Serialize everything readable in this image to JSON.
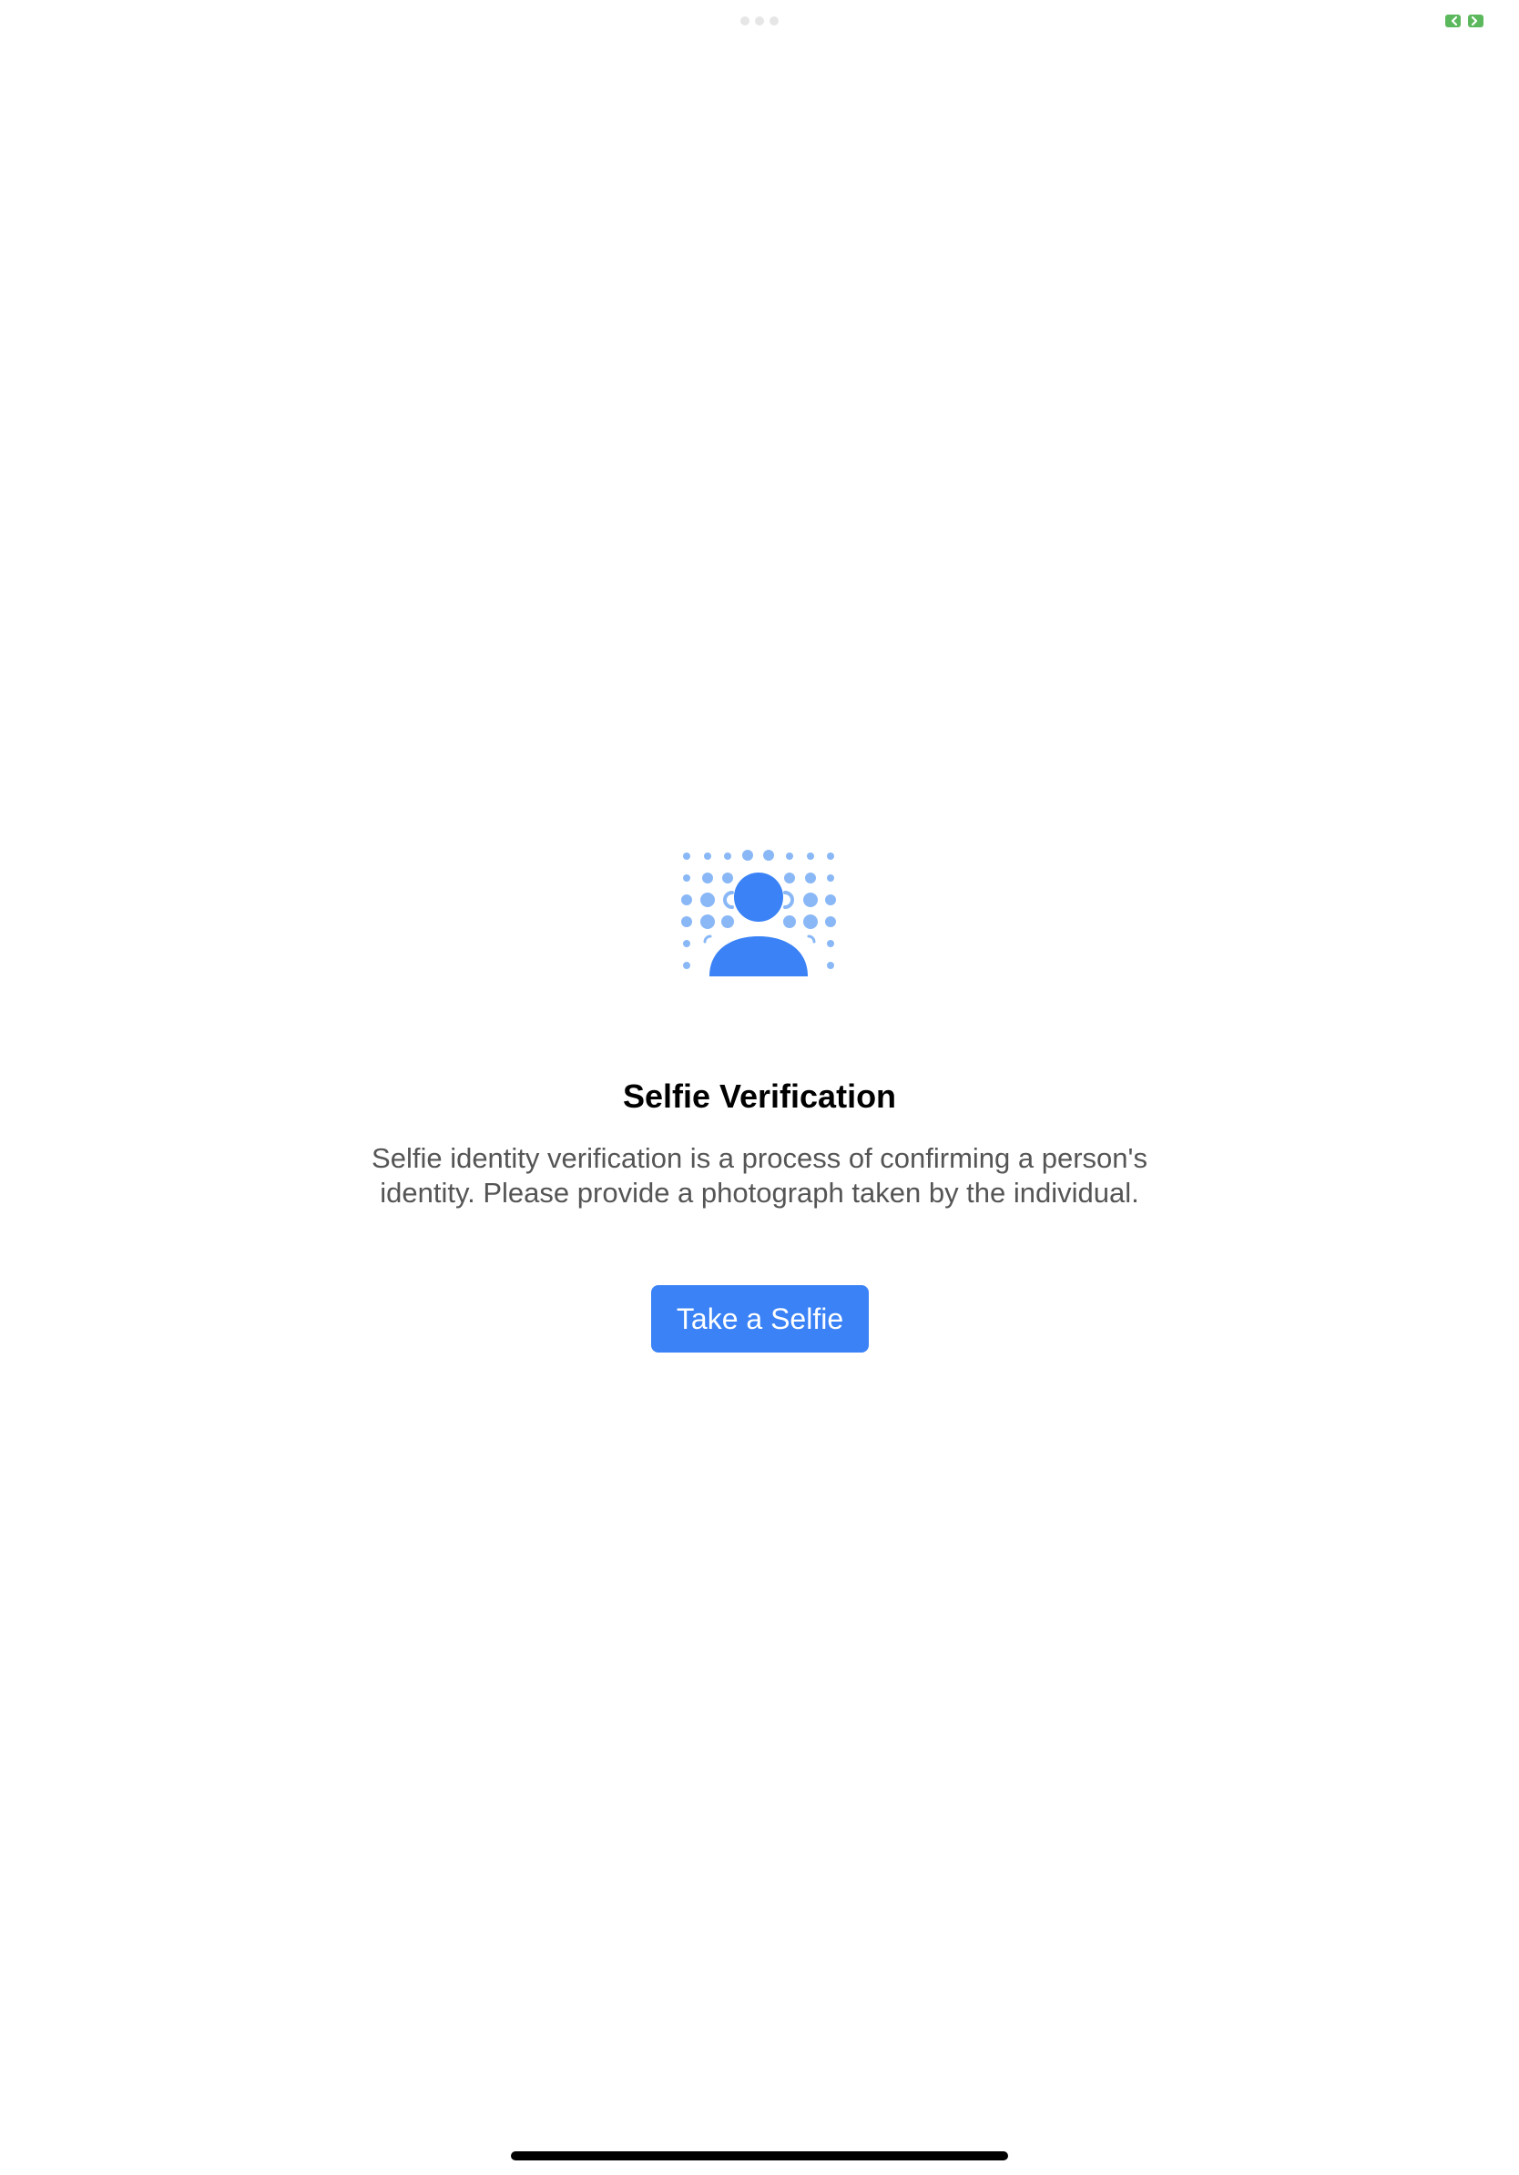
{
  "status_bar": {
    "multitasking_dots": 3,
    "resize_icon": "resize-arrows-icon",
    "resize_color": "#5cb85c"
  },
  "hero": {
    "icon": "selfie-face-scan-icon",
    "accent_color": "#3a82f6",
    "dot_color": "#8ab8f7"
  },
  "content": {
    "title": "Selfie Verification",
    "description_line1": "Selfie identity verification is a process of confirming a person's",
    "description_line2": "identity. Please provide a photograph taken by the individual."
  },
  "actions": {
    "take_selfie_label": "Take a Selfie"
  }
}
